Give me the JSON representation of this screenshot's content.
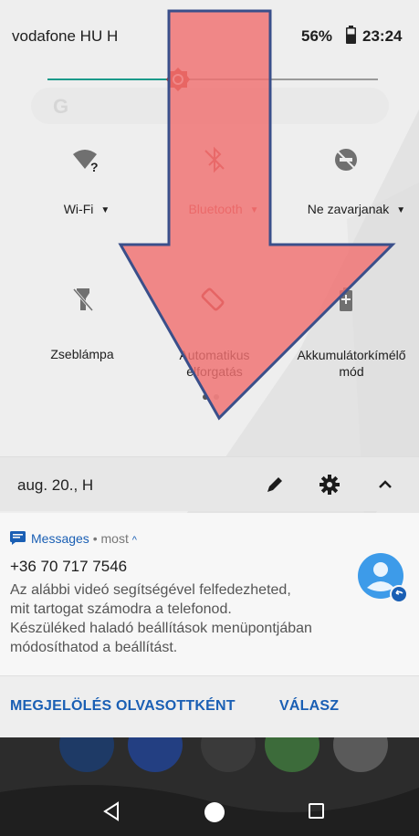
{
  "status_bar": {
    "carrier": "vodafone HU H",
    "battery_percent": "56%",
    "time": "23:24"
  },
  "brightness": {
    "level": 0.37
  },
  "quick_settings": {
    "tiles": [
      {
        "label": "Wi-Fi",
        "icon": "wifi-unknown-icon",
        "has_dropdown": true
      },
      {
        "label": "Bluetooth",
        "icon": "bluetooth-off-icon",
        "has_dropdown": true
      },
      {
        "label": "Ne zavarjanak",
        "icon": "do-not-disturb-icon",
        "has_dropdown": true
      },
      {
        "label": "Zseblámpa",
        "icon": "flashlight-icon"
      },
      {
        "label_line1": "Automatikus",
        "label_line2": "elforgatás",
        "icon": "auto-rotate-icon"
      },
      {
        "label_line1": "Akkumulátorkímélő",
        "label_line2": "mód",
        "icon": "battery-saver-icon"
      }
    ],
    "page_count": 2,
    "current_page": 1
  },
  "header": {
    "date": "aug. 20., H",
    "icons": [
      "edit-pencil-icon",
      "settings-gear-icon",
      "collapse-chevron-up-icon"
    ]
  },
  "notification": {
    "app_name": "Messages",
    "separator": "•",
    "time": "most",
    "expand_glyph": "^",
    "sender": "+36 70 717 7546",
    "body": [
      "Az alábbi videó segítségével felfedezheted,",
      "mit tartogat számodra a telefonod.",
      "Készüléked haladó beállítások menüpontjában",
      "módosíthatod a beállítást."
    ],
    "actions": {
      "mark_read": "MEGJELÖLÉS OLVASOTTKÉNT",
      "reply": "VÁLASZ"
    }
  },
  "navigation": {
    "icons": [
      "back-triangle-icon",
      "home-circle-icon",
      "recents-square-icon"
    ]
  },
  "colors": {
    "accent_blue": "#1a5fb4",
    "slider_teal": "#1a9a8a",
    "arrow_red": "#f07070",
    "arrow_outline": "#3a4f8a",
    "bluetooth_red": "#e04040"
  }
}
